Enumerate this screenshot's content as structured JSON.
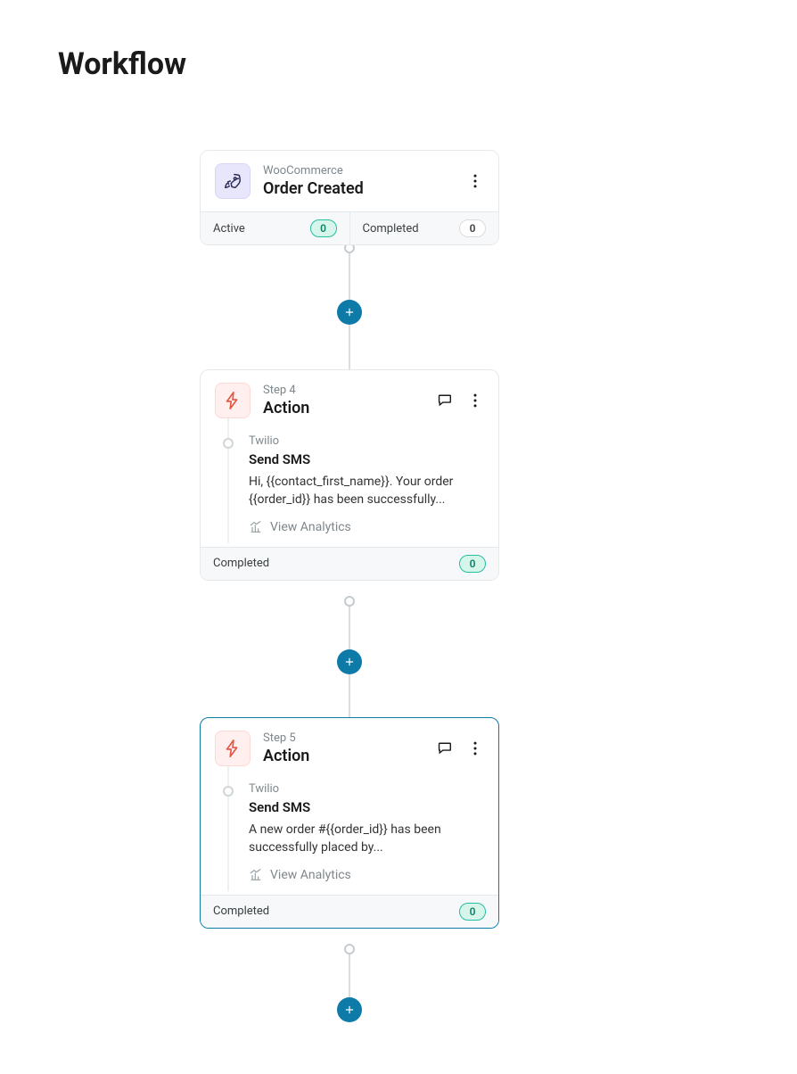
{
  "page_title": "Workflow",
  "trigger": {
    "overline": "WooCommerce",
    "title": "Order Created",
    "active_label": "Active",
    "active_count": "0",
    "completed_label": "Completed",
    "completed_count": "0"
  },
  "step4": {
    "overline": "Step 4",
    "title": "Action",
    "provider": "Twilio",
    "action_name": "Send SMS",
    "preview": "Hi, {{contact_first_name}}. Your order {{order_id}} has been successfully...",
    "analytics_label": "View Analytics",
    "completed_label": "Completed",
    "completed_count": "0"
  },
  "step5": {
    "overline": "Step 5",
    "title": "Action",
    "provider": "Twilio",
    "action_name": "Send SMS",
    "preview": "A new order #{{order_id}} has been successfully placed by...",
    "analytics_label": "View Analytics",
    "completed_label": "Completed",
    "completed_count": "0"
  }
}
